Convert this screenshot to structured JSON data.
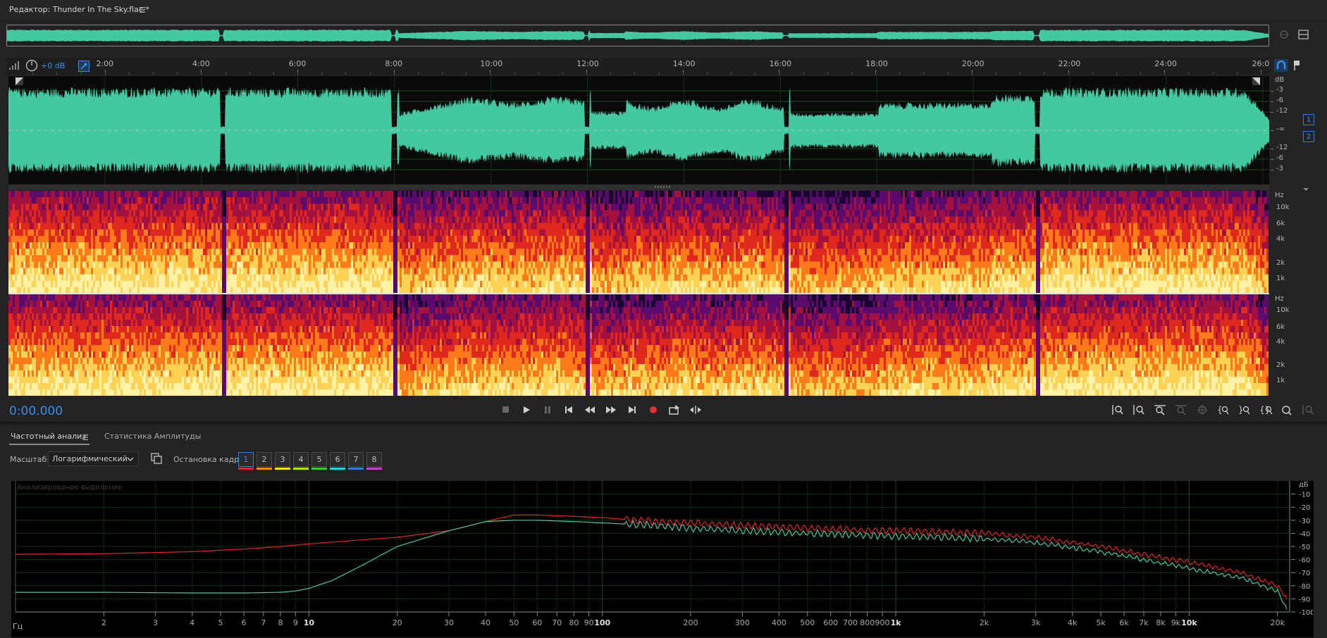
{
  "editor": {
    "title": "Редактор: Thunder In The Sky.flac *"
  },
  "overview": {
    "colors": {
      "waveform": "#43c8a2",
      "background": "#202020"
    }
  },
  "toolbar": {
    "volume_label": "+0 dB",
    "current_time": "0:00.000"
  },
  "timeline": {
    "ticks": [
      "2:00",
      "4:00",
      "6:00",
      "8:00",
      "10:00",
      "12:00",
      "14:00",
      "16:00",
      "18:00",
      "20:00",
      "22:00",
      "24:00",
      "26:0"
    ],
    "tick_values_seconds": [
      120,
      240,
      360,
      480,
      600,
      720,
      840,
      960,
      1080,
      1200,
      1320,
      1440,
      1560
    ],
    "end_seconds": 1568
  },
  "waveform_panel": {
    "db_unit": "dB",
    "db_labels": [
      "-3",
      "-6",
      "-12",
      "-∞",
      "-12",
      "-6",
      "-3"
    ],
    "channels": [
      "1",
      "2"
    ],
    "colors": {
      "waveform": "#43c8a2",
      "background": "#0a0a0a"
    }
  },
  "spectrogram_panel": {
    "unit": "Hz",
    "freq_labels": [
      "10k",
      "6k",
      "4k",
      "2k",
      "1k"
    ],
    "colors": [
      "#1a0530",
      "#5a0b6b",
      "#a3123f",
      "#e0291e",
      "#ff7a1a",
      "#ffd255",
      "#fff2a6"
    ]
  },
  "tabs": [
    {
      "label": "Частотный анализ",
      "active": true
    },
    {
      "label": "Статистика Амплитуды",
      "active": false
    }
  ],
  "controls": {
    "scale_label": "Масштаб:",
    "scale_value": "Логарифмический",
    "freeze_label": "Остановка кадра:",
    "frames": [
      {
        "label": "1",
        "color": "#e02626"
      },
      {
        "label": "2",
        "color": "#ff8a00"
      },
      {
        "label": "3",
        "color": "#f2e600"
      },
      {
        "label": "4",
        "color": "#b6e600"
      },
      {
        "label": "5",
        "color": "#29d42e"
      },
      {
        "label": "6",
        "color": "#19d6e8"
      },
      {
        "label": "7",
        "color": "#2b7cf0"
      },
      {
        "label": "8",
        "color": "#d63ad6"
      }
    ]
  },
  "frequency_plot": {
    "overlay_label": "Анализированое выделение",
    "y_unit": "дБ",
    "x_unit": "Гц"
  },
  "chart_data": {
    "type": "line",
    "title": "",
    "xlabel": "Гц",
    "ylabel": "дБ",
    "x_scale": "log",
    "xlim": [
      1,
      22000
    ],
    "ylim": [
      -100,
      0
    ],
    "grid": true,
    "y_ticks": [
      -10,
      -20,
      -30,
      -40,
      -50,
      -60,
      -70,
      -80,
      -90,
      -100
    ],
    "x_ticks": [
      {
        "v": 2,
        "l": "2"
      },
      {
        "v": 3,
        "l": "3"
      },
      {
        "v": 4,
        "l": "4"
      },
      {
        "v": 5,
        "l": "5"
      },
      {
        "v": 6,
        "l": "6"
      },
      {
        "v": 7,
        "l": "7"
      },
      {
        "v": 8,
        "l": "8"
      },
      {
        "v": 9,
        "l": "9"
      },
      {
        "v": 10,
        "l": "10"
      },
      {
        "v": 20,
        "l": "20"
      },
      {
        "v": 30,
        "l": "30"
      },
      {
        "v": 40,
        "l": "40"
      },
      {
        "v": 50,
        "l": "50"
      },
      {
        "v": 60,
        "l": "60"
      },
      {
        "v": 70,
        "l": "70"
      },
      {
        "v": 80,
        "l": "80"
      },
      {
        "v": 90,
        "l": "90"
      },
      {
        "v": 100,
        "l": "100"
      },
      {
        "v": 200,
        "l": "200"
      },
      {
        "v": 300,
        "l": "300"
      },
      {
        "v": 400,
        "l": "400"
      },
      {
        "v": 500,
        "l": "500"
      },
      {
        "v": 600,
        "l": "600"
      },
      {
        "v": 700,
        "l": "700"
      },
      {
        "v": 800,
        "l": "800"
      },
      {
        "v": 900,
        "l": "900"
      },
      {
        "v": 1000,
        "l": "1k"
      },
      {
        "v": 2000,
        "l": "2k"
      },
      {
        "v": 3000,
        "l": "3k"
      },
      {
        "v": 4000,
        "l": "4k"
      },
      {
        "v": 5000,
        "l": "5k"
      },
      {
        "v": 6000,
        "l": "6k"
      },
      {
        "v": 7000,
        "l": "7k"
      },
      {
        "v": 8000,
        "l": "8k"
      },
      {
        "v": 9000,
        "l": "9k"
      },
      {
        "v": 10000,
        "l": "10k"
      },
      {
        "v": 20000,
        "l": "20k"
      }
    ],
    "series": [
      {
        "color": "#e02626",
        "x": [
          1,
          2,
          4,
          6,
          8,
          10,
          15,
          20,
          30,
          40,
          50,
          60,
          80,
          100,
          150,
          200,
          300,
          500,
          700,
          1000,
          2000,
          3000,
          5000,
          7000,
          10000,
          15000,
          20000,
          21500
        ],
        "y": [
          -56,
          -55.5,
          -54,
          -52,
          -50,
          -48,
          -45,
          -43,
          -38,
          -31,
          -26,
          -26,
          -27,
          -28,
          -31,
          -32,
          -34,
          -36,
          -37,
          -38,
          -40,
          -43,
          -50,
          -56,
          -62,
          -70,
          -80,
          -90
        ]
      },
      {
        "color": "#43c8a2",
        "x": [
          1,
          2,
          4,
          6,
          8,
          9,
          10,
          12,
          15,
          20,
          30,
          40,
          50,
          60,
          80,
          100,
          150,
          200,
          300,
          500,
          700,
          1000,
          2000,
          3000,
          5000,
          7000,
          10000,
          15000,
          20000,
          21500
        ],
        "y": [
          -85,
          -85,
          -85.5,
          -85.5,
          -85,
          -84,
          -82,
          -76,
          -65,
          -50,
          -38,
          -31,
          -30,
          -30,
          -31,
          -32,
          -34,
          -36,
          -38,
          -40,
          -41,
          -42,
          -44,
          -47,
          -54,
          -60,
          -67,
          -74,
          -84,
          -98
        ]
      }
    ]
  }
}
